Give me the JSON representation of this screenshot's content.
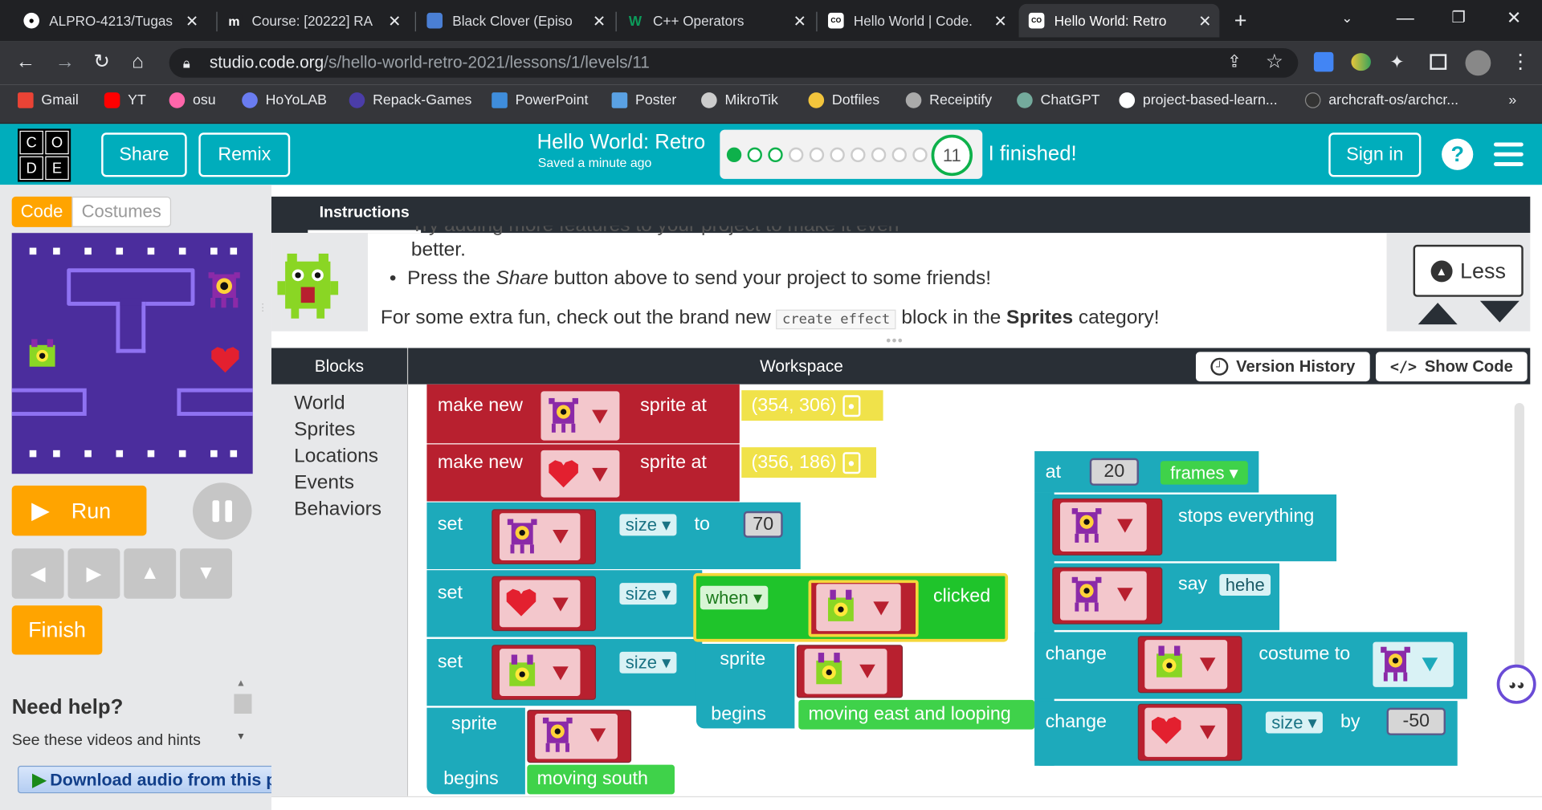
{
  "browser": {
    "tabs": [
      {
        "title": "ALPRO-4213/Tugas",
        "icon": "github-icon"
      },
      {
        "title": "Course: [20222] RA",
        "icon": "moodle-icon"
      },
      {
        "title": "Black Clover (Episo",
        "icon": "video-icon"
      },
      {
        "title": "C++ Operators",
        "icon": "w3schools-icon"
      },
      {
        "title": "Hello World | Code.",
        "icon": "codeorg-icon"
      },
      {
        "title": "Hello World: Retro",
        "icon": "codeorg-icon"
      }
    ],
    "new_tab": "+",
    "url_domain": "studio.code.org",
    "url_path": "/s/hello-world-retro-2021/lessons/1/levels/11",
    "bookmarks": [
      "Gmail",
      "YT",
      "osu",
      "HoYoLAB",
      "Repack-Games",
      "PowerPoint",
      "Poster",
      "MikroTik",
      "Dotfiles",
      "Receiptify",
      "ChatGPT",
      "project-based-learn...",
      "archcraft-os/archcr..."
    ],
    "bookmarks_more": "»"
  },
  "header": {
    "logo_letters": [
      "C",
      "O",
      "D",
      "E"
    ],
    "share": "Share",
    "remix": "Remix",
    "project_title": "Hello World: Retro",
    "saved": "Saved a minute ago",
    "level": "11",
    "finished": "I finished!",
    "sign_in": "Sign in",
    "help": "?"
  },
  "left": {
    "tab_code": "Code",
    "tab_costumes": "Costumes",
    "run": "Run",
    "finish": "Finish",
    "need_help": "Need help?",
    "see_hints": "See these videos and hints",
    "download_audio": "Download audio from this page"
  },
  "instructions": {
    "tab": "Instructions",
    "line_cut": "Try adding more features to your project to make it even",
    "line1": "better.",
    "bullet_pre": "Press the ",
    "bullet_em": "Share",
    "bullet_post": " button above to send your project to some friends!",
    "extra_pre": "For some extra fun, check out the brand new ",
    "extra_code": "create effect",
    "extra_mid": " block in the ",
    "extra_bold": "Sprites",
    "extra_post": " category!",
    "less": "Less"
  },
  "workspace": {
    "blocks_header": "Blocks",
    "workspace_header": "Workspace",
    "version_history": "Version History",
    "show_code": "Show Code",
    "toolbox": [
      "World",
      "Sprites",
      "Locations",
      "Events",
      "Behaviors"
    ]
  },
  "code_blocks": {
    "make_new": "make new",
    "sprite_at": "sprite at",
    "coord1": "(354, 306)",
    "coord2": "(356, 186)",
    "set": "set",
    "size": "size",
    "to": "to",
    "size_value": "70",
    "when": "when",
    "clicked": "clicked",
    "sprite": "sprite",
    "begins": "begins",
    "moving_east": "moving east and looping",
    "moving_south": "moving south",
    "at": "at",
    "frames_value": "20",
    "frames": "frames",
    "stops_everything": "stops everything",
    "say": "say",
    "say_text": "hehe",
    "change": "change",
    "costume_to": "costume to",
    "by": "by",
    "by_value": "-50"
  },
  "colors": {
    "codeorg_teal": "#00adbc",
    "sprite_block_red": "#b8202f",
    "event_block_teal": "#1daabb",
    "when_green": "#1fc42b",
    "location_yellow": "#f0e24a",
    "run_orange": "#ffa400",
    "stage_purple": "#4b2d9d"
  }
}
